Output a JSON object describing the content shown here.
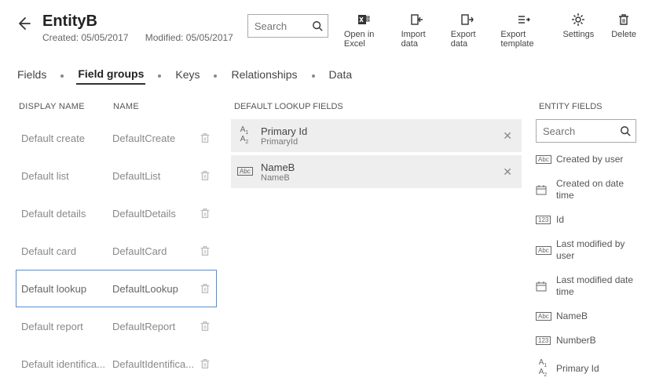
{
  "header": {
    "title": "EntityB",
    "created_label": "Created: 05/05/2017",
    "modified_label": "Modified: 05/05/2017",
    "search_placeholder": "Search"
  },
  "toolbar": {
    "open_excel": "Open in Excel",
    "import_data": "Import data",
    "export_data": "Export data",
    "export_template": "Export template",
    "settings": "Settings",
    "delete": "Delete"
  },
  "tabs": {
    "fields": "Fields",
    "field_groups": "Field groups",
    "keys": "Keys",
    "relationships": "Relationships",
    "data": "Data"
  },
  "field_groups": {
    "header_display": "DISPLAY NAME",
    "header_name": "NAME",
    "rows": [
      {
        "display": "Default create",
        "name": "DefaultCreate"
      },
      {
        "display": "Default list",
        "name": "DefaultList"
      },
      {
        "display": "Default details",
        "name": "DefaultDetails"
      },
      {
        "display": "Default card",
        "name": "DefaultCard"
      },
      {
        "display": "Default lookup",
        "name": "DefaultLookup"
      },
      {
        "display": "Default report",
        "name": "DefaultReport"
      },
      {
        "display": "Default identifica...",
        "name": "DefaultIdentifica..."
      }
    ],
    "selected_index": 4
  },
  "lookup": {
    "title": "DEFAULT LOOKUP FIELDS",
    "rows": [
      {
        "type": "text",
        "label": "Primary Id",
        "sub": "PrimaryId"
      },
      {
        "type": "abc",
        "label": "NameB",
        "sub": "NameB"
      }
    ]
  },
  "entity_fields": {
    "title": "ENTITY FIELDS",
    "search_placeholder": "Search",
    "rows": [
      {
        "type": "abc",
        "label": "Created by user"
      },
      {
        "type": "date",
        "label": "Created on date time"
      },
      {
        "type": "num",
        "label": "Id"
      },
      {
        "type": "abc",
        "label": "Last modified by user"
      },
      {
        "type": "date",
        "label": "Last modified date time"
      },
      {
        "type": "abc",
        "label": "NameB"
      },
      {
        "type": "num",
        "label": "NumberB"
      },
      {
        "type": "text",
        "label": "Primary Id"
      }
    ]
  }
}
